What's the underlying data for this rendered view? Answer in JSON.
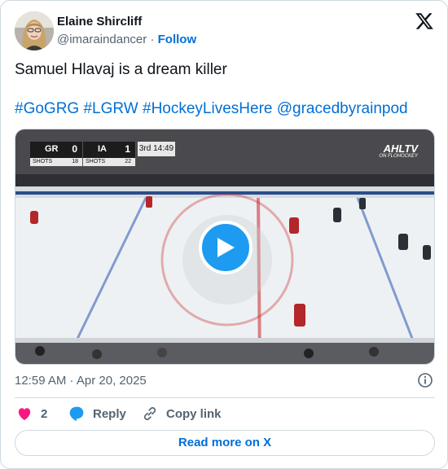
{
  "author": {
    "name": "Elaine Shircliff",
    "handle": "@imaraindancer",
    "separator": "·",
    "follow_label": "Follow"
  },
  "tweet": {
    "text": "Samuel Hlavaj is a dream killer",
    "hashtags": [
      "#GoGRG",
      "#LGRW",
      "#HockeyLivesHere",
      "@gracedbyrainpod"
    ],
    "timestamp": "12:59 AM · Apr 20, 2025"
  },
  "video": {
    "scoreboard": {
      "home": {
        "abbr": "GR",
        "score": "0",
        "shots_label": "SHOTS",
        "shots": "18"
      },
      "away": {
        "abbr": "IA",
        "score": "1",
        "shots_label": "SHOTS",
        "shots": "22"
      },
      "clock": "3rd 14:49"
    },
    "broadcaster": "AHLTV",
    "broadcaster_sub": "ON FLOHOCKEY"
  },
  "actions": {
    "like_count": "2",
    "reply_label": "Reply",
    "copy_label": "Copy link"
  },
  "read_more_label": "Read more on X",
  "colors": {
    "brand_blue": "#1d9bf0",
    "link_blue": "#006fd6",
    "like_pink": "#f91880",
    "text_primary": "#0f1419",
    "text_secondary": "#536471",
    "border": "#cfd9de"
  },
  "icons": [
    "x-logo-icon",
    "play-icon",
    "heart-icon",
    "reply-bubble-icon",
    "link-icon",
    "info-icon"
  ]
}
